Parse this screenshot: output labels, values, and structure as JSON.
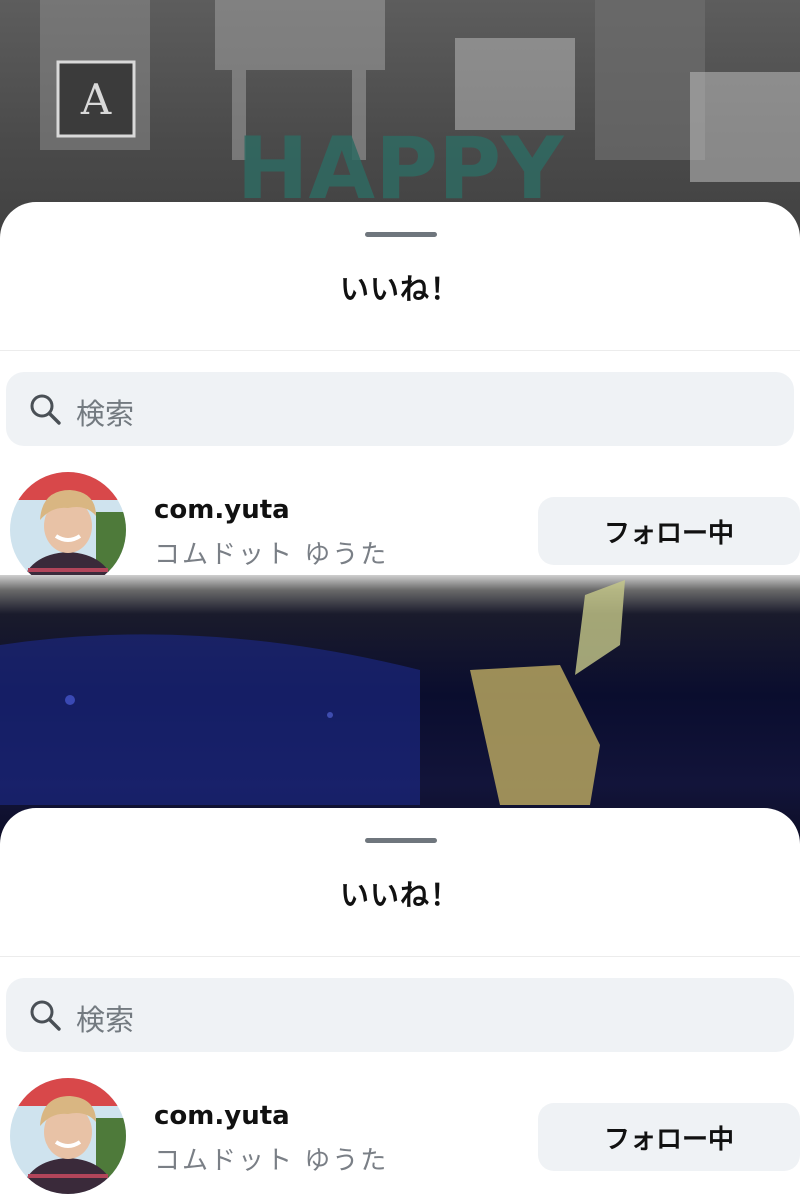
{
  "background_top": {
    "letters": [
      "A",
      "HAPPY"
    ]
  },
  "sheets": [
    {
      "title": "いいね！",
      "search": {
        "placeholder": "検索",
        "icon": "search-icon"
      },
      "user": {
        "username": "com.yuta",
        "display_name": "コムドット ゆうた",
        "follow_label": "フォロー中"
      }
    },
    {
      "title": "いいね！",
      "search": {
        "placeholder": "検索",
        "icon": "search-icon"
      },
      "user": {
        "username": "com.yuta",
        "display_name": "コムドット ゆうた",
        "follow_label": "フォロー中"
      }
    }
  ],
  "colors": {
    "sheet_bg": "#ffffff",
    "search_bg": "#eff2f5",
    "button_bg": "#eff2f5",
    "handle": "#6f767d",
    "secondary_text": "#7a7f86",
    "primary_text": "#111111"
  }
}
